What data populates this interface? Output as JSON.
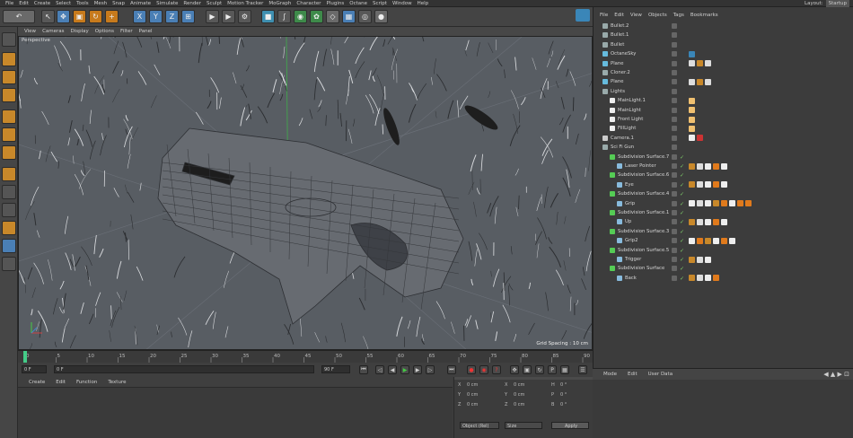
{
  "menubar": {
    "items": [
      "File",
      "Edit",
      "Create",
      "Select",
      "Tools",
      "Mesh",
      "Snap",
      "Animate",
      "Simulate",
      "Render",
      "Sculpt",
      "Motion Tracker",
      "MoGraph",
      "Character",
      "Plugins",
      "Octane",
      "Script",
      "Window",
      "Help"
    ],
    "layout_label": "Layout:",
    "layout_value": "Startup"
  },
  "viewport": {
    "menu": [
      "View",
      "Cameras",
      "Display",
      "Options",
      "Filter",
      "Panel"
    ],
    "camera_label": "Perspective",
    "grid_spacing": "Grid Spacing : 10 cm"
  },
  "timeline": {
    "ticks": [
      "0",
      "5",
      "10",
      "15",
      "20",
      "25",
      "30",
      "35",
      "40",
      "45",
      "50",
      "55",
      "60",
      "65",
      "70",
      "75",
      "80",
      "85",
      "90"
    ],
    "current_frame": "0 F",
    "start_field": "0 F",
    "end_field": "90 F",
    "end_field2": "90 F",
    "min_field": "0 F"
  },
  "object_manager": {
    "menu": [
      "File",
      "Edit",
      "View",
      "Objects",
      "Tags",
      "Bookmarks"
    ],
    "rows": [
      {
        "name": "Bullet.2",
        "indent": 0,
        "icon": "null"
      },
      {
        "name": "Bullet.1",
        "indent": 0,
        "icon": "null"
      },
      {
        "name": "Bullet",
        "indent": 0,
        "icon": "null"
      },
      {
        "name": "OctaneSky",
        "indent": 0,
        "icon": "sky"
      },
      {
        "name": "Plane",
        "indent": 0,
        "icon": "plane"
      },
      {
        "name": "Cloner.2",
        "indent": 0,
        "icon": "null"
      },
      {
        "name": "Plane",
        "indent": 0,
        "icon": "plane"
      },
      {
        "name": "Lights",
        "indent": 0,
        "icon": "null"
      },
      {
        "name": "MainLight.1",
        "indent": 1,
        "icon": "light"
      },
      {
        "name": "MainLight",
        "indent": 1,
        "icon": "light"
      },
      {
        "name": "Front Light",
        "indent": 1,
        "icon": "light"
      },
      {
        "name": "FillLight",
        "indent": 1,
        "icon": "light"
      },
      {
        "name": "Camera.1",
        "indent": 0,
        "icon": "camera"
      },
      {
        "name": "Sci Fi Gun",
        "indent": 0,
        "icon": "null"
      },
      {
        "name": "Subdivision Surface.7",
        "indent": 1,
        "icon": "subd"
      },
      {
        "name": "Laser Pointer",
        "indent": 2,
        "icon": "poly"
      },
      {
        "name": "Subdivision Surface.6",
        "indent": 1,
        "icon": "subd"
      },
      {
        "name": "Eye",
        "indent": 2,
        "icon": "poly"
      },
      {
        "name": "Subdivision Surface.4",
        "indent": 1,
        "icon": "subd"
      },
      {
        "name": "Grip",
        "indent": 2,
        "icon": "poly"
      },
      {
        "name": "Subdivision Surface.1",
        "indent": 1,
        "icon": "subd"
      },
      {
        "name": "Up",
        "indent": 2,
        "icon": "poly"
      },
      {
        "name": "Subdivision Surface.3",
        "indent": 1,
        "icon": "subd"
      },
      {
        "name": "Grip2",
        "indent": 2,
        "icon": "poly"
      },
      {
        "name": "Subdivision Surface.5",
        "indent": 1,
        "icon": "subd"
      },
      {
        "name": "Trigger",
        "indent": 2,
        "icon": "poly"
      },
      {
        "name": "Subdivision Surface",
        "indent": 1,
        "icon": "subd"
      },
      {
        "name": "Back",
        "indent": 2,
        "icon": "poly"
      }
    ]
  },
  "material_manager": {
    "menu": [
      "Create",
      "Edit",
      "Function",
      "Texture"
    ]
  },
  "coordinates": {
    "rows": [
      {
        "a": "X",
        "av": "0 cm",
        "b": "X",
        "bv": "0 cm",
        "c": "H",
        "cv": "0 °"
      },
      {
        "a": "Y",
        "av": "0 cm",
        "b": "Y",
        "bv": "0 cm",
        "c": "P",
        "cv": "0 °"
      },
      {
        "a": "Z",
        "av": "0 cm",
        "b": "Z",
        "bv": "0 cm",
        "c": "B",
        "cv": "0 °"
      }
    ],
    "mode": "Object (Rel)",
    "size_mode": "Size",
    "apply": "Apply"
  },
  "attribute_manager": {
    "menu": [
      "Mode",
      "Edit",
      "User Data"
    ]
  },
  "colors": {
    "accent": "#4a7fb5",
    "orange": "#c8882a",
    "viewport_bg": "#5a5f66"
  }
}
